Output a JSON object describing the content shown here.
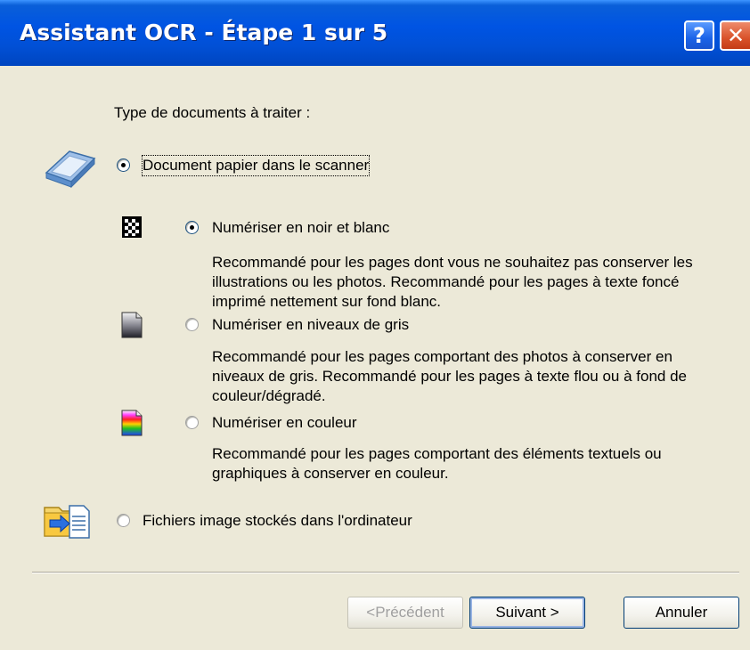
{
  "window": {
    "title": "Assistant OCR - Étape 1 sur 5",
    "help_label": "?",
    "close_label": "✕"
  },
  "main": {
    "prompt": "Type de documents à traiter :",
    "source_options": [
      {
        "label": "Document papier dans le scanner",
        "selected": true,
        "icon": "scanner-icon"
      },
      {
        "label": "Fichiers image stockés dans l'ordinateur",
        "selected": false,
        "icon": "folder-file-icon"
      }
    ],
    "scan_modes": [
      {
        "label": "Numériser en noir et blanc",
        "selected": true,
        "icon": "black-white-icon",
        "description": "Recommandé pour les pages dont vous ne souhaitez pas conserver les illustrations ou les photos. Recommandé pour les pages à texte foncé imprimé nettement sur fond blanc."
      },
      {
        "label": "Numériser en niveaux de gris",
        "selected": false,
        "icon": "grayscale-icon",
        "description": "Recommandé pour les pages comportant des photos à conserver en niveaux de gris. Recommandé pour les pages à texte flou ou à fond de couleur/dégradé."
      },
      {
        "label": "Numériser en couleur",
        "selected": false,
        "icon": "color-icon",
        "description": "Recommandé pour les pages comportant des éléments textuels ou graphiques à conserver en couleur."
      }
    ]
  },
  "footer": {
    "back_label": "<Précédent",
    "next_label": "Suivant >",
    "cancel_label": "Annuler"
  },
  "colors": {
    "titlebar": "#0054e3",
    "dialog_bg": "#ece9d8"
  }
}
